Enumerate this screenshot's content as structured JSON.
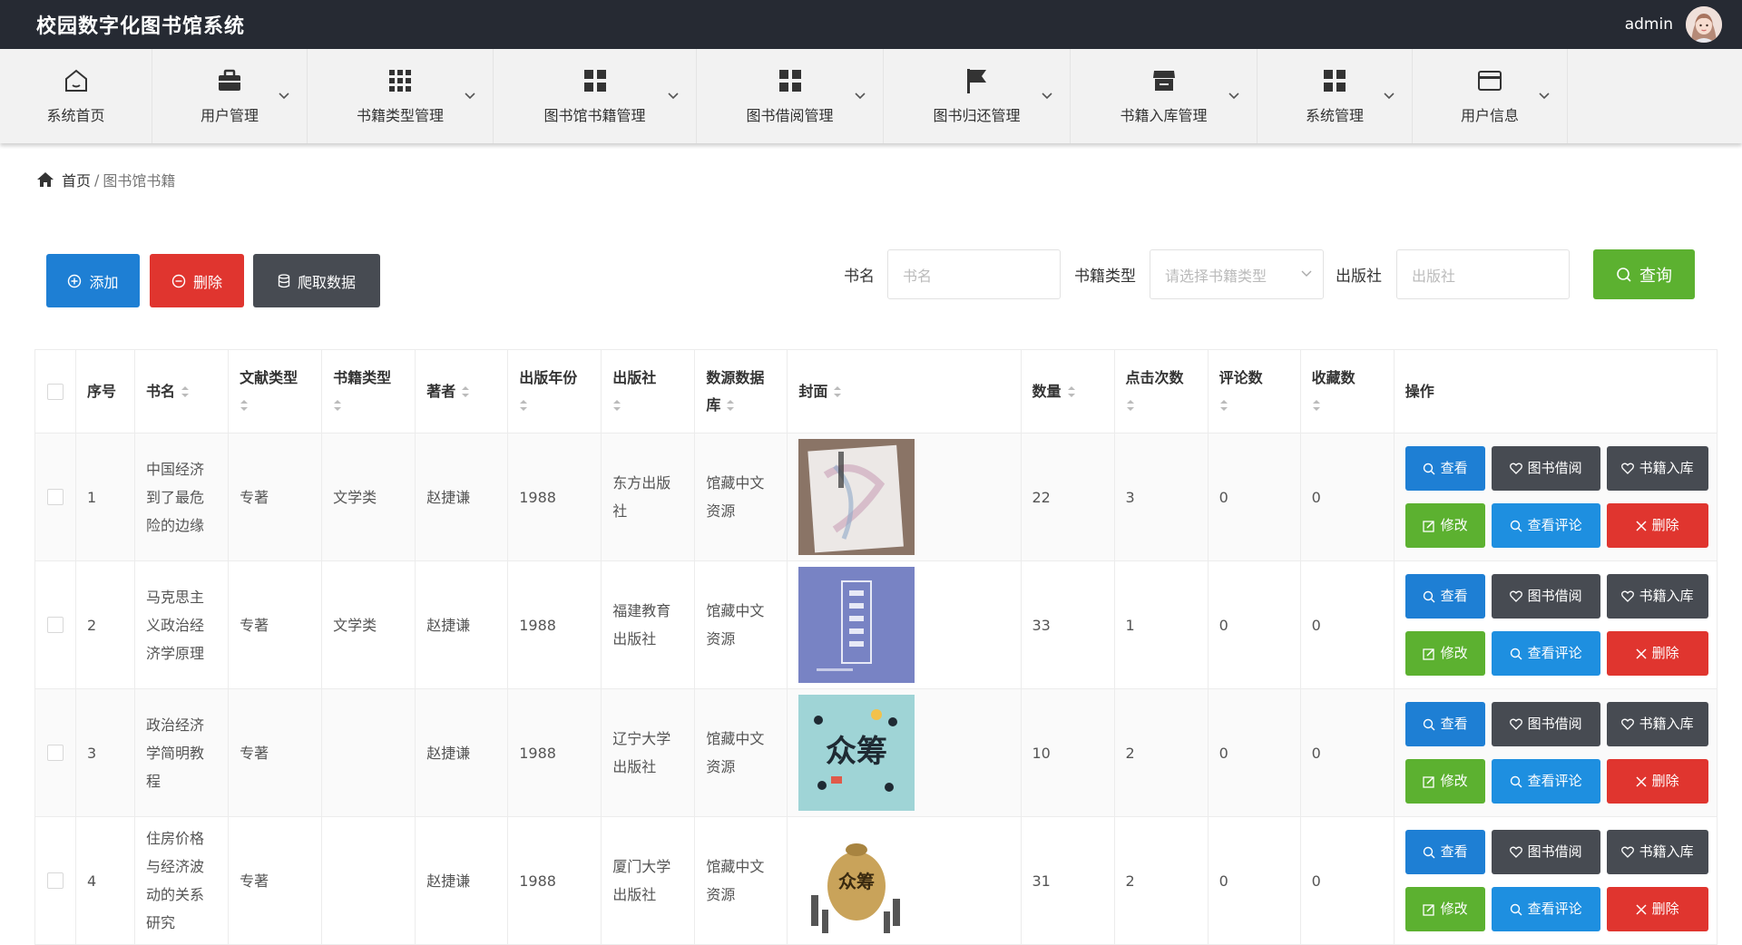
{
  "app": {
    "title": "校园数字化图书馆系统",
    "username": "admin"
  },
  "nav": [
    {
      "label": "系统首页",
      "icon": "home-icon",
      "dropdown": false
    },
    {
      "label": "用户管理",
      "icon": "briefcase-icon",
      "dropdown": true
    },
    {
      "label": "书籍类型管理",
      "icon": "grid-icon",
      "dropdown": true
    },
    {
      "label": "图书馆书籍管理",
      "icon": "apps-icon",
      "dropdown": true
    },
    {
      "label": "图书借阅管理",
      "icon": "apps-icon",
      "dropdown": true
    },
    {
      "label": "图书归还管理",
      "icon": "flag-icon",
      "dropdown": true
    },
    {
      "label": "书籍入库管理",
      "icon": "store-icon",
      "dropdown": true
    },
    {
      "label": "系统管理",
      "icon": "apps-icon",
      "dropdown": true
    },
    {
      "label": "用户信息",
      "icon": "card-icon",
      "dropdown": true
    }
  ],
  "breadcrumb": {
    "home": "首页",
    "separator": "/",
    "current": "图书馆书籍"
  },
  "toolbar": {
    "add": "添加",
    "delete": "删除",
    "crawl": "爬取数据"
  },
  "filters": {
    "name_label": "书名",
    "name_placeholder": "书名",
    "type_label": "书籍类型",
    "type_placeholder": "请选择书籍类型",
    "publisher_label": "出版社",
    "publisher_placeholder": "出版社",
    "query": "查询"
  },
  "table": {
    "headers": {
      "index": "序号",
      "name": "书名",
      "doc_type": "文献类型",
      "book_type": "书籍类型",
      "author": "著者",
      "year": "出版年份",
      "publisher": "出版社",
      "source": "数源数据库",
      "cover": "封面",
      "quantity": "数量",
      "clicks": "点击次数",
      "comments": "评论数",
      "favorites": "收藏数",
      "actions": "操作"
    },
    "rows": [
      {
        "index": "1",
        "name": "中国经济到了最危险的边缘",
        "doc_type": "专著",
        "book_type": "文学类",
        "author": "赵捷谦",
        "year": "1988",
        "publisher": "东方出版社",
        "source": "馆藏中文资源",
        "quantity": "22",
        "clicks": "3",
        "comments": "0",
        "favorites": "0"
      },
      {
        "index": "2",
        "name": "马克思主义政治经济学原理",
        "doc_type": "专著",
        "book_type": "文学类",
        "author": "赵捷谦",
        "year": "1988",
        "publisher": "福建教育出版社",
        "source": "馆藏中文资源",
        "quantity": "33",
        "clicks": "1",
        "comments": "0",
        "favorites": "0"
      },
      {
        "index": "3",
        "name": "政治经济学简明教程",
        "doc_type": "专著",
        "book_type": "",
        "author": "赵捷谦",
        "year": "1988",
        "publisher": "辽宁大学出版社",
        "source": "馆藏中文资源",
        "quantity": "10",
        "clicks": "2",
        "comments": "0",
        "favorites": "0"
      },
      {
        "index": "4",
        "name": "住房价格与经济波动的关系研究",
        "doc_type": "专著",
        "book_type": "",
        "author": "赵捷谦",
        "year": "1988",
        "publisher": "厦门大学出版社",
        "source": "馆藏中文资源",
        "quantity": "31",
        "clicks": "2",
        "comments": "0",
        "favorites": "0"
      }
    ],
    "actions": {
      "view": "查看",
      "borrow": "图书借阅",
      "stock": "书籍入库",
      "edit": "修改",
      "comment": "查看评论",
      "delete": "删除"
    }
  },
  "colors": {
    "topbar": "#262a33",
    "primary": "#1e7fd4",
    "danger": "#e0352f",
    "success": "#5cb130",
    "dark": "#474b52"
  }
}
